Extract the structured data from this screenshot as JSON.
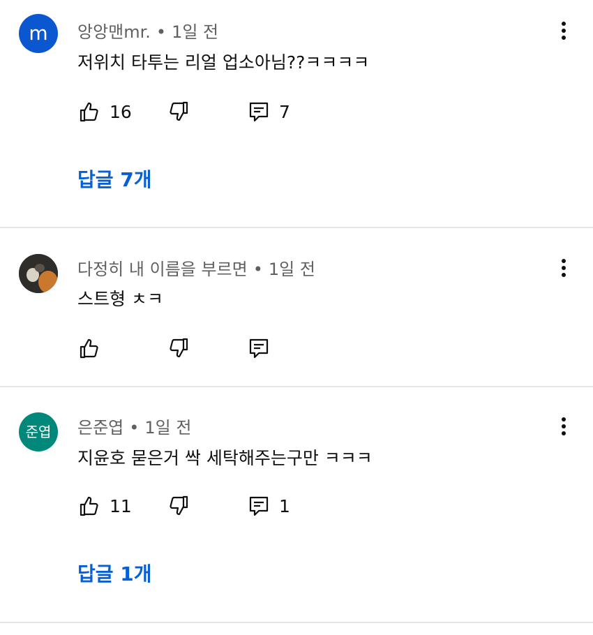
{
  "comments": [
    {
      "avatar_text": "m",
      "avatar_color": "#0b57d0",
      "author": "앙앙맨mr.",
      "time": "1일 전",
      "text": "저위치 타투는 리얼 업소아님??ㅋㅋㅋㅋ",
      "likes": "16",
      "reply_count": "7",
      "replies_label": "답글 7개"
    },
    {
      "avatar_text": "",
      "author": "다정히 내 이름을 부르면",
      "time": "1일 전",
      "text": "스트형 ㅊㅋ",
      "likes": "",
      "reply_count": ""
    },
    {
      "avatar_text": "준엽",
      "avatar_color": "#00897b",
      "author": "은준엽",
      "time": "1일 전",
      "text": "지윤호 묻은거 싹 세탁해주는구만 ㅋㅋㅋ",
      "likes": "11",
      "reply_count": "1",
      "replies_label": "답글 1개"
    }
  ],
  "separator": "•",
  "colors": {
    "link": "#065fd4",
    "meta": "#606060",
    "divider": "#e5e5e5"
  },
  "icons": {
    "like": "thumbs-up-icon",
    "dislike": "thumbs-down-icon",
    "reply": "reply-icon",
    "more": "more-vert-icon"
  }
}
